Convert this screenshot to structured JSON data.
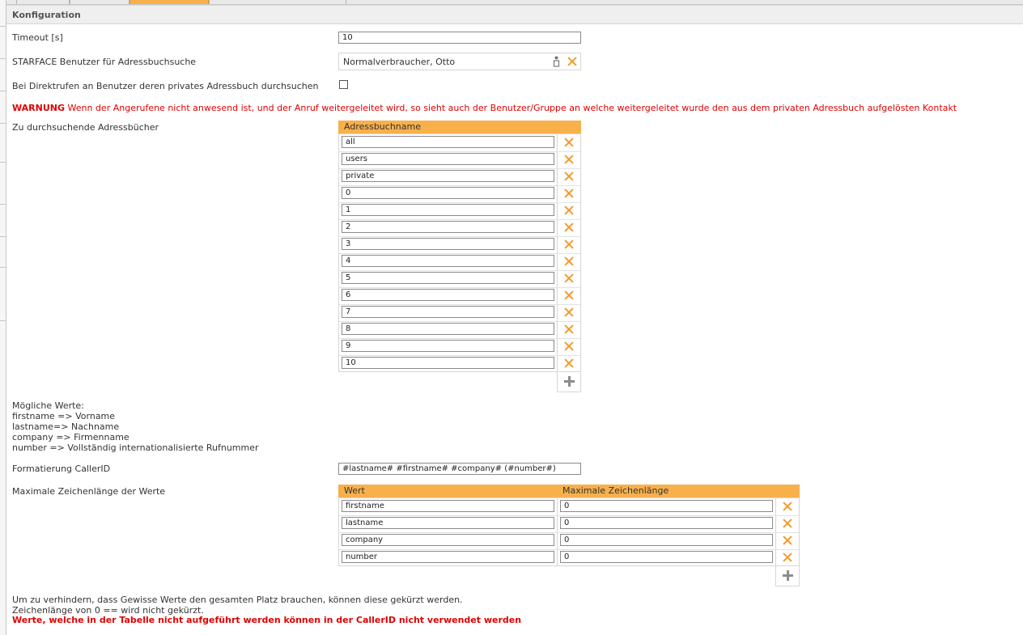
{
  "section_title": "Konfiguration",
  "timeout": {
    "label": "Timeout [s]",
    "value": "10"
  },
  "starface_user": {
    "label": "STARFACE Benutzer für Adressbuchsuche",
    "value": "Normalverbraucher, Otto"
  },
  "direct_calls": {
    "label": "Bei Direktrufen an Benutzer deren privates Adressbuch durchsuchen",
    "checked": false
  },
  "warning": {
    "prefix": "WARNUNG",
    "text": "Wenn der Angerufene nicht anwesend ist, und der Anruf weitergeleitet wird, so sieht auch der Benutzer/Gruppe an welche weitergeleitet wurde den aus dem privaten Adressbuch aufgelösten Kontakt"
  },
  "address_books": {
    "label": "Zu durchsuchende Adressbücher",
    "column": "Adressbuchname",
    "rows": [
      "all",
      "users",
      "private",
      "0",
      "1",
      "2",
      "3",
      "4",
      "5",
      "6",
      "7",
      "8",
      "9",
      "10"
    ]
  },
  "possible_values": {
    "lines": [
      "Mögliche Werte:",
      "firstname => Vorname",
      "lastname=> Nachname",
      "company => Firmenname",
      "number => Vollständig internationalisierte Rufnummer"
    ]
  },
  "callerid_format": {
    "label": "Formatierung CallerID",
    "value": "#lastname# #firstname# #company# (#number#)"
  },
  "max_length": {
    "label": "Maximale Zeichenlänge der Werte",
    "col_value": "Wert",
    "col_max": "Maximale Zeichenlänge",
    "rows": [
      {
        "value": "firstname",
        "max": "0"
      },
      {
        "value": "lastname",
        "max": "0"
      },
      {
        "value": "company",
        "max": "0"
      },
      {
        "value": "number",
        "max": "0"
      }
    ]
  },
  "footer": {
    "line1": "Um zu verhindern, dass Gewisse Werte den gesamten Platz brauchen, können diese gekürzt werden.",
    "line2": "Zeichenlänge von 0 == wird nicht gekürzt.",
    "error": "Werte, welche in der Tabelle nicht aufgeführt werden können in der CallerID nicht verwendet werden"
  },
  "colors": {
    "accent": "#f8b04b",
    "delete": "#f19a2e",
    "warning": "#e00000"
  }
}
